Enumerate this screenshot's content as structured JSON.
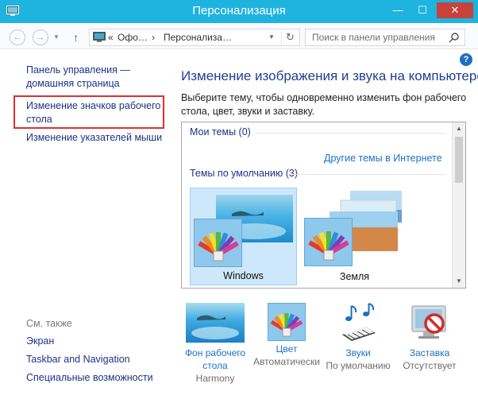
{
  "window": {
    "title": "Персонализация",
    "min": "—",
    "max": "☐",
    "close": "✕"
  },
  "nav": {
    "back": "←",
    "forward": "→",
    "up": "↑",
    "crumb1": "Офо…",
    "crumb2": "Персонализа…",
    "crumb_sep": "›",
    "crumb_prefix": "«",
    "search_placeholder": "Поиск в панели управления"
  },
  "help": "?",
  "sidebar": {
    "home_line1": "Панель управления —",
    "home_line2": "домашняя страница",
    "icons_line1": "Изменение значков рабочего",
    "icons_line2": "стола",
    "pointers": "Изменение указателей мыши",
    "see_also": "См. также",
    "links": [
      "Экран",
      "Taskbar and Navigation",
      "Специальные возможности"
    ]
  },
  "main": {
    "heading": "Изменение изображения и звука на компьютере",
    "description": "Выберите тему, чтобы одновременно изменить фон рабочего стола, цвет, звуки и заставку."
  },
  "themes": {
    "my_themes": "Мои темы (0)",
    "online": "Другие темы в Интернете",
    "default_themes": "Темы по умолчанию (3)",
    "items": [
      {
        "label": "Windows",
        "selected": true
      },
      {
        "label": "Земля",
        "selected": false
      }
    ]
  },
  "options": [
    {
      "name_line1": "Фон рабочего",
      "name_line2": "стола",
      "value": "Harmony"
    },
    {
      "name_line1": "Цвет",
      "name_line2": "",
      "value": "Автоматически"
    },
    {
      "name_line1": "Звуки",
      "name_line2": "",
      "value": "По умолчанию"
    },
    {
      "name_line1": "Заставка",
      "name_line2": "",
      "value": "Отсутствует"
    }
  ],
  "colors": {
    "titlebar": "#1fb3e0",
    "close": "#c7423a",
    "link": "#1e3287",
    "heading": "#1f3f93",
    "accent_link": "#1e70c8",
    "highlight_box": "#d93333"
  }
}
